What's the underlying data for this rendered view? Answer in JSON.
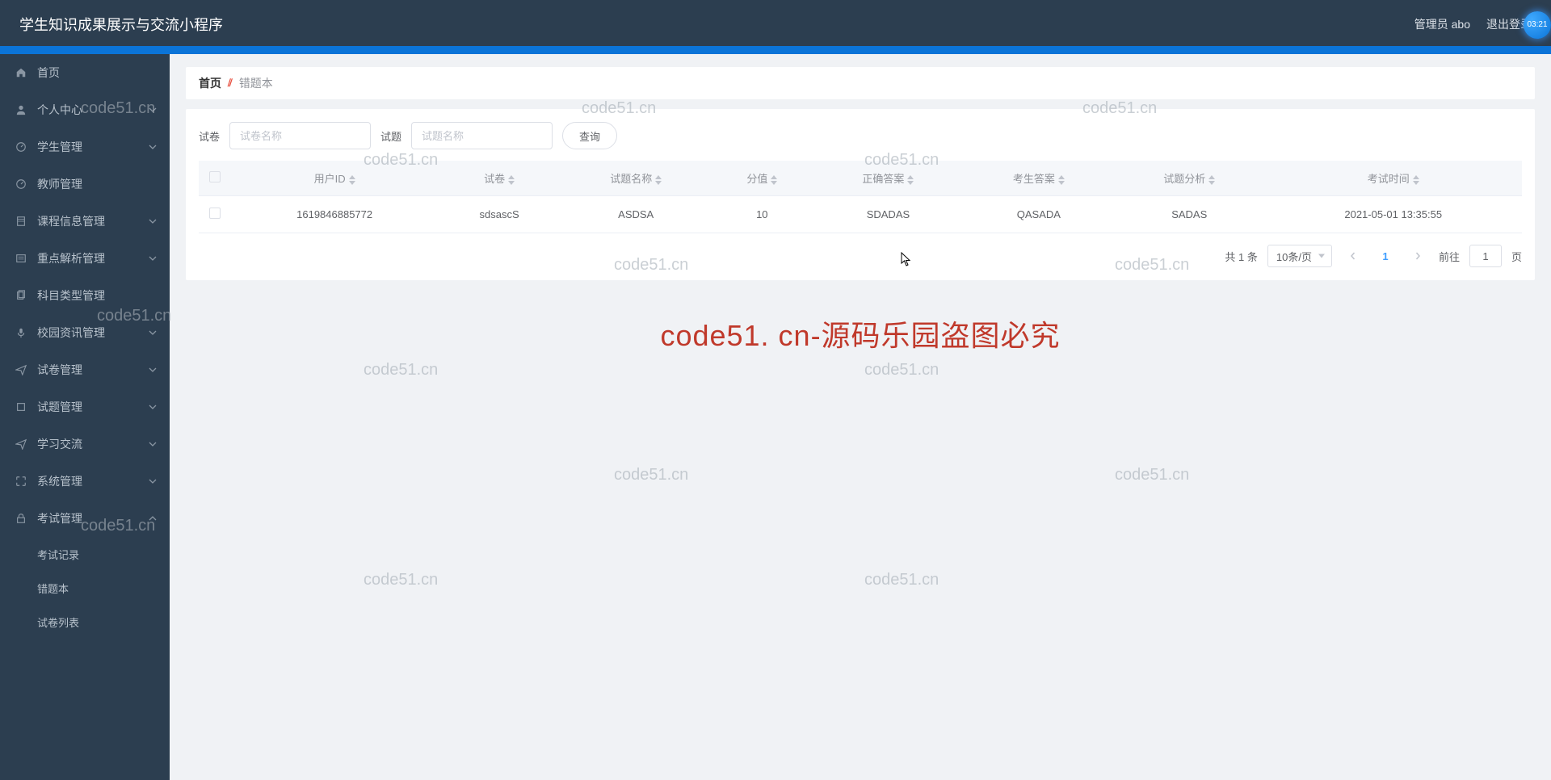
{
  "header": {
    "title": "学生知识成果展示与交流小程序",
    "user_label": "管理员 abo",
    "logout_label": "退出登录",
    "clock_badge": "03:21"
  },
  "sidebar": {
    "items": [
      {
        "icon": "home",
        "label": "首页",
        "expandable": false
      },
      {
        "icon": "user",
        "label": "个人中心",
        "expandable": true,
        "chevron": "down"
      },
      {
        "icon": "gauge",
        "label": "学生管理",
        "expandable": true,
        "chevron": "down"
      },
      {
        "icon": "gauge",
        "label": "教师管理",
        "expandable": false
      },
      {
        "icon": "book",
        "label": "课程信息管理",
        "expandable": true,
        "chevron": "down"
      },
      {
        "icon": "list",
        "label": "重点解析管理",
        "expandable": true,
        "chevron": "down"
      },
      {
        "icon": "copy",
        "label": "科目类型管理",
        "expandable": false
      },
      {
        "icon": "mic",
        "label": "校园资讯管理",
        "expandable": true,
        "chevron": "down"
      },
      {
        "icon": "send",
        "label": "试卷管理",
        "expandable": true,
        "chevron": "down"
      },
      {
        "icon": "square",
        "label": "试题管理",
        "expandable": true,
        "chevron": "down"
      },
      {
        "icon": "send",
        "label": "学习交流",
        "expandable": true,
        "chevron": "down"
      },
      {
        "icon": "expand",
        "label": "系统管理",
        "expandable": true,
        "chevron": "down"
      },
      {
        "icon": "lock",
        "label": "考试管理",
        "expandable": true,
        "chevron": "up"
      }
    ],
    "sub_items": [
      "考试记录",
      "错题本",
      "试卷列表"
    ]
  },
  "breadcrumb": {
    "home": "首页",
    "current": "错题本"
  },
  "filters": {
    "label1": "试卷",
    "placeholder1": "试卷名称",
    "label2": "试题",
    "placeholder2": "试题名称",
    "query_btn": "查询"
  },
  "table": {
    "columns": [
      "用户ID",
      "试卷",
      "试题名称",
      "分值",
      "正确答案",
      "考生答案",
      "试题分析",
      "考试时间"
    ],
    "rows": [
      [
        "1619846885772",
        "sdsascS",
        "ASDSA",
        "10",
        "SDADAS",
        "QASADA",
        "SADAS",
        "2021-05-01 13:35:55"
      ]
    ]
  },
  "pagination": {
    "total_label": "共 1 条",
    "page_size": "10条/页",
    "current_page": "1",
    "goto_prefix": "前往",
    "goto_value": "1",
    "goto_suffix": "页"
  },
  "watermarks": {
    "text": "code51.cn",
    "main": "code51. cn-源码乐园盗图必究"
  }
}
